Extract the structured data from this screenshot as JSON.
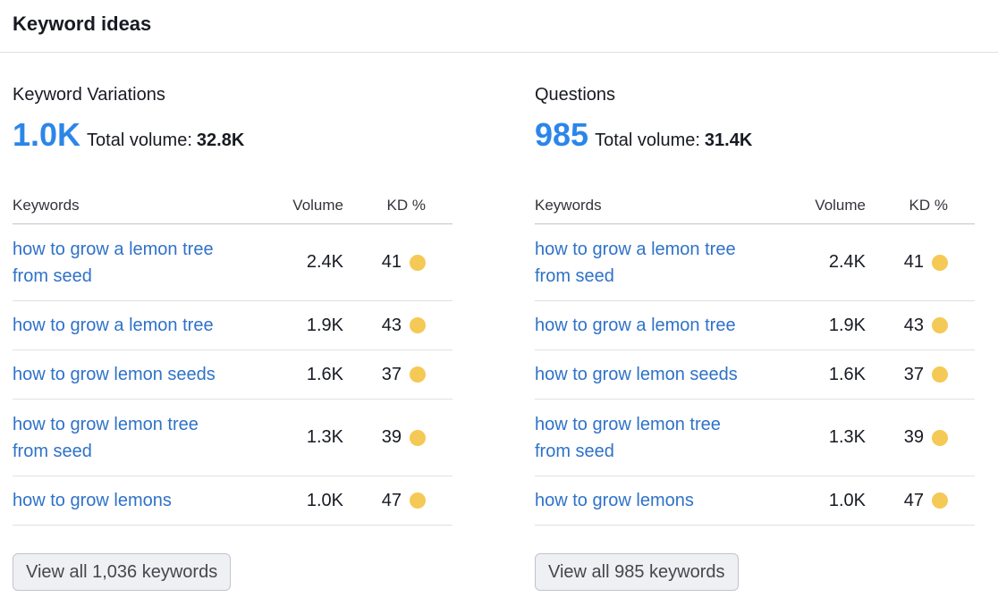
{
  "header": {
    "title": "Keyword ideas"
  },
  "colors": {
    "link": "#2f72c8",
    "accent": "#2c86e8",
    "kd_medium": "#f5c955"
  },
  "table_headers": {
    "keywords": "Keywords",
    "volume": "Volume",
    "kd": "KD %"
  },
  "variations": {
    "title": "Keyword Variations",
    "count": "1.0K",
    "total_label": "Total volume:",
    "total_value": "32.8K",
    "rows": [
      {
        "keyword_line1": "how to grow a lemon tree",
        "keyword_line2": "from seed",
        "volume": "2.4K",
        "kd": "41"
      },
      {
        "keyword_line1": "how to grow a lemon tree",
        "keyword_line2": "",
        "volume": "1.9K",
        "kd": "43"
      },
      {
        "keyword_line1": "how to grow lemon seeds",
        "keyword_line2": "",
        "volume": "1.6K",
        "kd": "37"
      },
      {
        "keyword_line1": "how to grow lemon tree",
        "keyword_line2": "from seed",
        "volume": "1.3K",
        "kd": "39"
      },
      {
        "keyword_line1": "how to grow lemons",
        "keyword_line2": "",
        "volume": "1.0K",
        "kd": "47"
      }
    ],
    "view_all_label": "View all 1,036 keywords"
  },
  "questions": {
    "title": "Questions",
    "count": "985",
    "total_label": "Total volume:",
    "total_value": "31.4K",
    "rows": [
      {
        "keyword_line1": "how to grow a lemon tree",
        "keyword_line2": "from seed",
        "volume": "2.4K",
        "kd": "41"
      },
      {
        "keyword_line1": "how to grow a lemon tree",
        "keyword_line2": "",
        "volume": "1.9K",
        "kd": "43"
      },
      {
        "keyword_line1": "how to grow lemon seeds",
        "keyword_line2": "",
        "volume": "1.6K",
        "kd": "37"
      },
      {
        "keyword_line1": "how to grow lemon tree",
        "keyword_line2": "from seed",
        "volume": "1.3K",
        "kd": "39"
      },
      {
        "keyword_line1": "how to grow lemons",
        "keyword_line2": "",
        "volume": "1.0K",
        "kd": "47"
      }
    ],
    "view_all_label": "View all 985 keywords"
  }
}
